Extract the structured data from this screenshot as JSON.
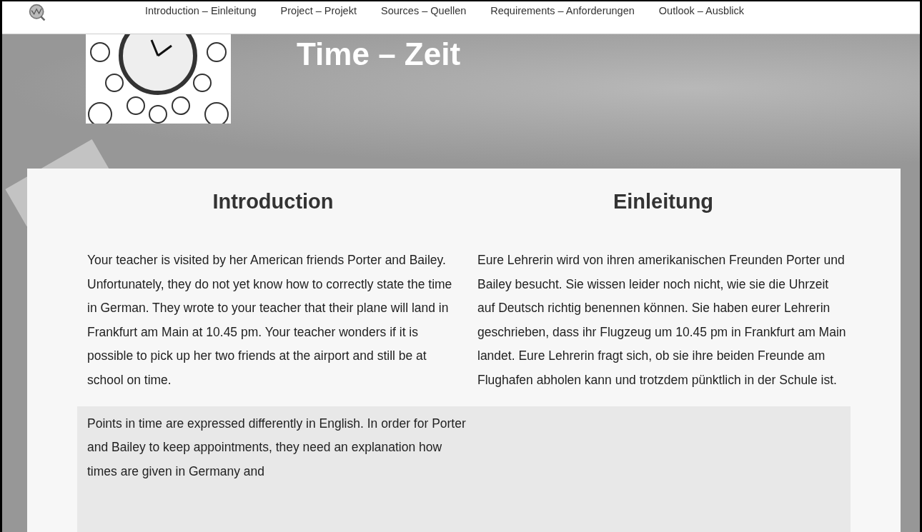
{
  "nav": {
    "items": [
      {
        "label": "Introduction – Einleitung",
        "selected": false
      },
      {
        "label": "Project – Projekt",
        "selected": false
      },
      {
        "label": "Sources – Quellen",
        "selected": false
      },
      {
        "label": "Requirements – Anforderungen",
        "selected": false
      },
      {
        "label": "Outlook – Ausblick",
        "selected": false
      }
    ]
  },
  "header": {
    "title": "Time – Zeit"
  },
  "columns": [
    {
      "heading": "Introduction",
      "text": "Your teacher is visited by her American friends Porter and Bailey. Unfortunately, they do not yet know how to correctly state the time in German. They wrote to your teacher that their plane will land in Frankfurt am Main at 10.45 pm. Your teacher wonders if it is possible to pick up her two friends at the airport and still be at school on time."
    },
    {
      "heading": "Einleitung",
      "text": "Eure Lehrerin wird von ihren amerikanischen Freunden Porter und Bailey besucht. Sie wissen leider noch nicht, wie sie die Uhrzeit auf Deutsch richtig benennen können. Sie haben eurer Lehrerin geschrieben, dass ihr Flugzeug um 10.45 pm in Frankfurt am Main landet. Eure Lehrerin fragt sich, ob sie ihre beiden Freunde am Flughafen abholen kann und trotzdem pünktlich in der Schule ist."
    }
  ],
  "note": {
    "text": "Points in time are expressed differently in English. In order for Porter and Bailey to keep appointments, they need an explanation how times are given in Germany and"
  }
}
